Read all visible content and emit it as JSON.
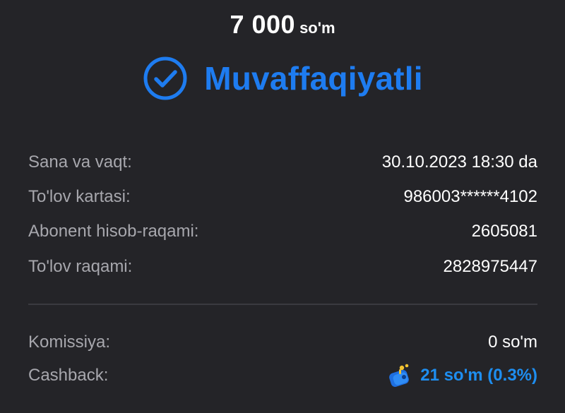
{
  "payment": {
    "amount": "7 000",
    "currency": "so'm",
    "status": "Muvaffaqiyatli",
    "status_icon": "check-circle-icon"
  },
  "details": [
    {
      "label": "Sana va vaqt:",
      "value": "30.10.2023 18:30 da"
    },
    {
      "label": "To'lov kartasi:",
      "value": "986003******4102"
    },
    {
      "label": "Abonent hisob-raqami:",
      "value": "2605081"
    },
    {
      "label": "To'lov raqami:",
      "value": "2828975447"
    }
  ],
  "fees": {
    "commission_label": "Komissiya:",
    "commission_value": "0 so'm",
    "cashback_label": "Cashback:",
    "cashback_value": "21 so'm (0.3%)",
    "cashback_icon": "wallet-coin-icon"
  },
  "colors": {
    "background": "#242428",
    "accent": "#1e7cf0",
    "label": "#a7a7ad",
    "divider": "#3a3a40"
  }
}
